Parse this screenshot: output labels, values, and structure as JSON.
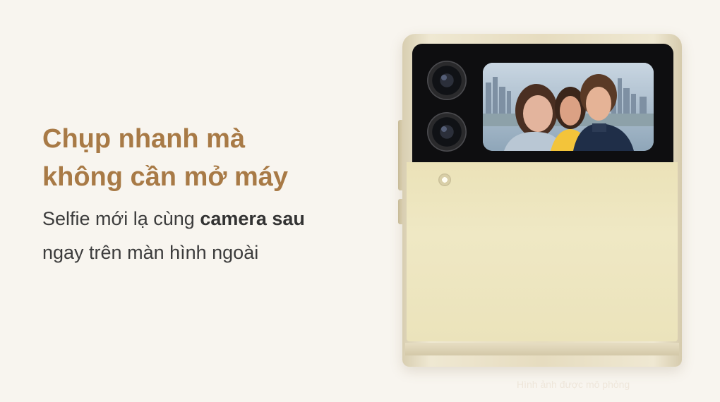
{
  "headline": {
    "line1": "Chụp nhanh mà",
    "line2": "không cần mở máy"
  },
  "subtext": {
    "line1_prefix": "Selfie mới lạ cùng ",
    "line1_bold": "camera sau",
    "line2": "ngay trên màn hình ngoài"
  },
  "watermark": "Hình ảnh được mô phỏng",
  "colors": {
    "background": "#f8f5ef",
    "headline": "#a87a46",
    "body_text": "#3c3c3c",
    "phone_cream": "#ebe2b8"
  }
}
